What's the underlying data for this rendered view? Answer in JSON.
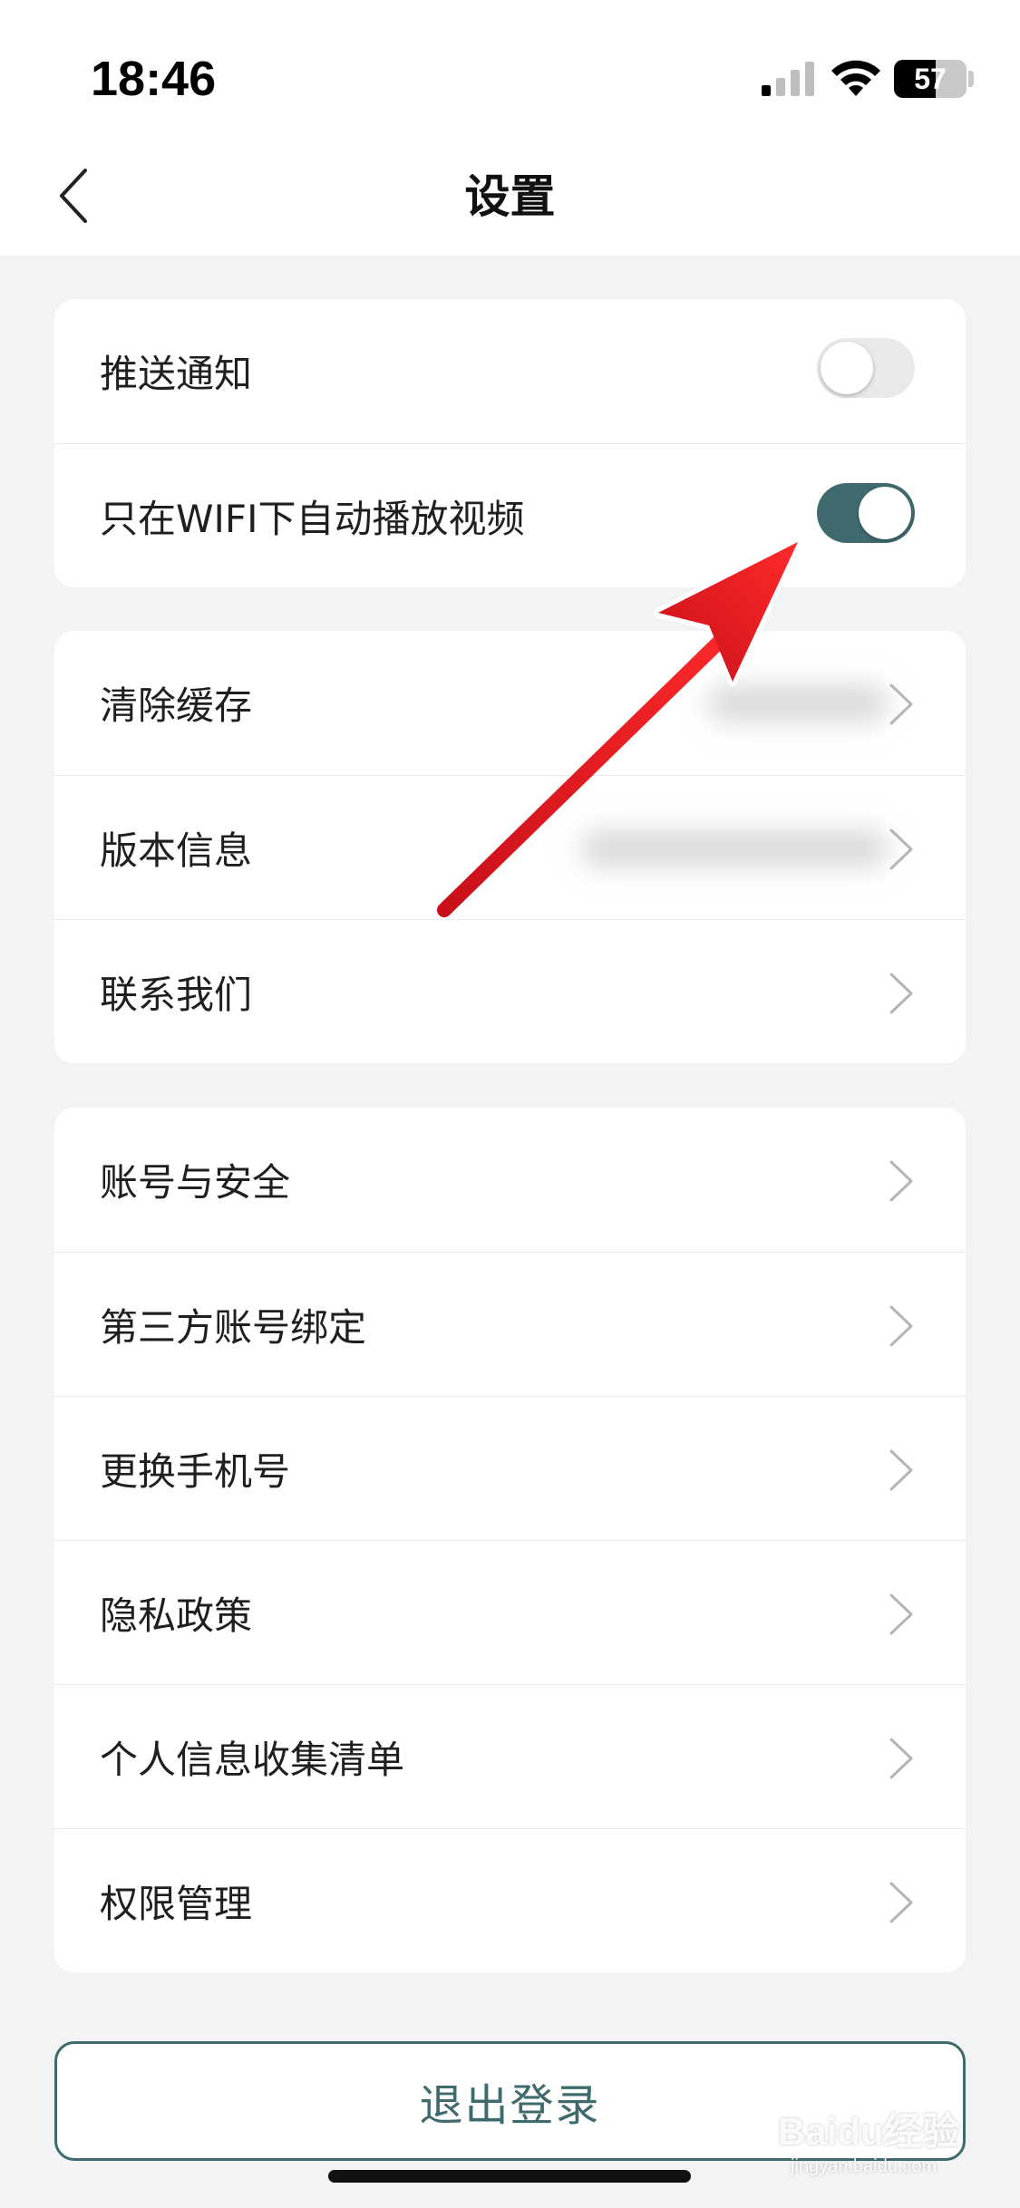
{
  "status_bar": {
    "time": "18:46",
    "battery": "57",
    "battery_level": 0.57
  },
  "header": {
    "title": "设置",
    "back_icon": "chevron-left-icon"
  },
  "section1": {
    "rows": [
      {
        "label": "推送通知",
        "toggle_on": false
      },
      {
        "label": "只在WIFI下自动播放视频",
        "toggle_on": true
      }
    ]
  },
  "section2": {
    "rows": [
      {
        "label": "清除缓存"
      },
      {
        "label": "版本信息"
      },
      {
        "label": "联系我们"
      }
    ]
  },
  "section3": {
    "rows": [
      {
        "label": "账号与安全"
      },
      {
        "label": "第三方账号绑定"
      },
      {
        "label": "更换手机号"
      },
      {
        "label": "隐私政策"
      },
      {
        "label": "个人信息收集清单"
      },
      {
        "label": "权限管理"
      }
    ]
  },
  "logout": {
    "label": "退出登录"
  },
  "watermark": {
    "brand": "Baidu经验",
    "url": "jingyan.baidu.com"
  },
  "colors": {
    "accent": "#3f6b6f",
    "annotation_arrow": "#e8171f",
    "background": "#f2f3f5"
  }
}
